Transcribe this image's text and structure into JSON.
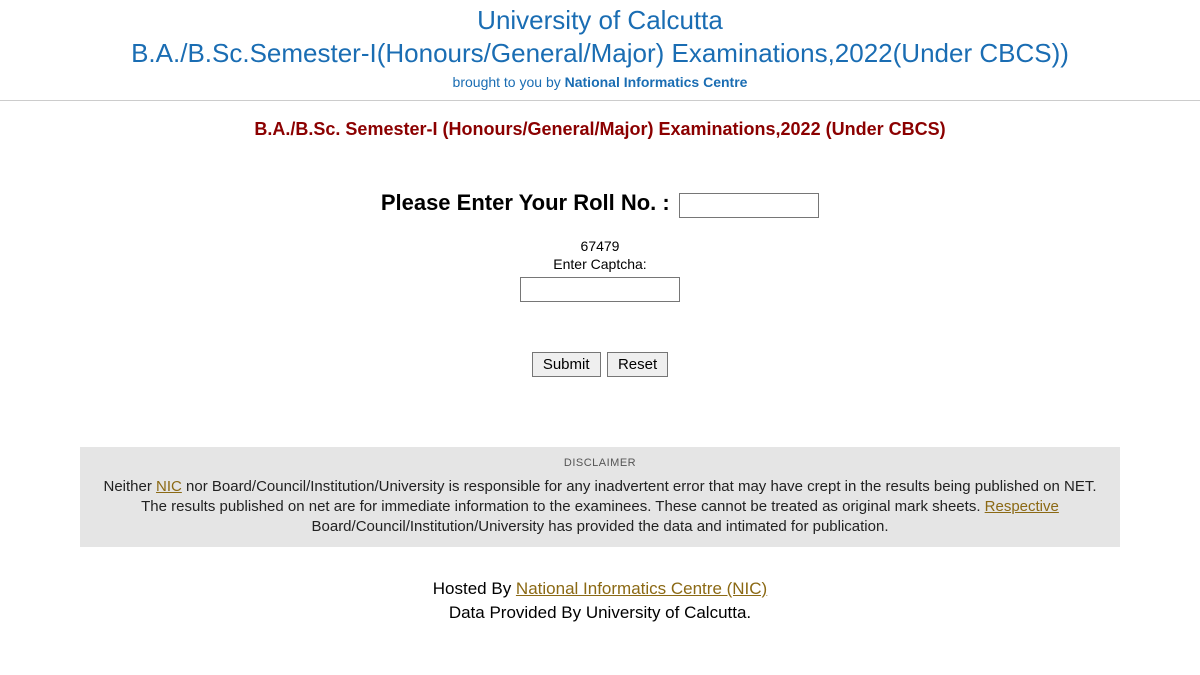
{
  "header": {
    "title_main": "University of Calcutta",
    "title_sub": "B.A./B.Sc.Semester-I(Honours/General/Major) Examinations,2022(Under CBCS))",
    "brought_by_prefix": "brought to you by ",
    "brought_by_org": "National Informatics Centre"
  },
  "exam_heading": "B.A./B.Sc. Semester-I (Honours/General/Major) Examinations,2022 (Under CBCS)",
  "form": {
    "roll_label": "Please Enter Your Roll No. :",
    "captcha_code": "67479",
    "captcha_label": "Enter Captcha:",
    "submit_label": "Submit",
    "reset_label": "Reset"
  },
  "disclaimer": {
    "title": "DISCLAIMER",
    "text_prefix": "Neither ",
    "nic_link": "NIC",
    "text_mid1": " nor Board/Council/Institution/University is responsible for any inadvertent error that may have crept in the results being published on NET. The results published on net are for immediate information to the examinees. These cannot be treated as original mark sheets. ",
    "respective_link": "Respective",
    "text_end": " Board/Council/Institution/University has provided the data and intimated for publication."
  },
  "footer": {
    "hosted_prefix": "Hosted By ",
    "hosted_link": "National Informatics Centre (NIC)",
    "data_by": "Data Provided By University of Calcutta."
  }
}
